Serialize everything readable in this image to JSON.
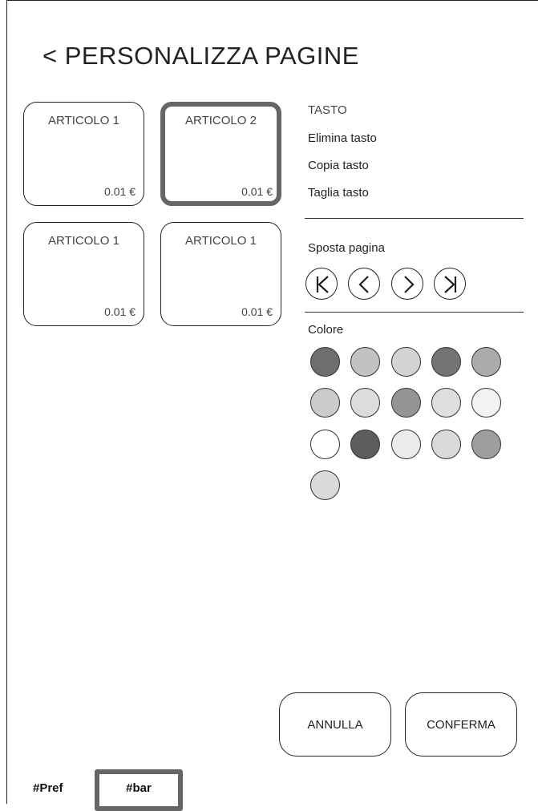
{
  "header": {
    "title": "< PERSONALIZZA PAGINE"
  },
  "tiles": [
    {
      "name": "ARTICOLO 1",
      "price": "0.01 €",
      "selected": false
    },
    {
      "name": "ARTICOLO 2",
      "price": "0.01 €",
      "selected": true
    },
    {
      "name": "ARTICOLO 1",
      "price": "0.01 €",
      "selected": false
    },
    {
      "name": "ARTICOLO 1",
      "price": "0.01 €",
      "selected": false
    }
  ],
  "panel": {
    "section_title": "TASTO",
    "actions": [
      "Elimina tasto",
      "Copia tasto",
      "Taglia tasto"
    ],
    "move_label": "Sposta pagina",
    "move_buttons": [
      "first-page-icon",
      "previous-page-icon",
      "next-page-icon",
      "last-page-icon"
    ],
    "color_label": "Colore",
    "colors": [
      "#6e6e6e",
      "#c2c2c2",
      "#d3d3d3",
      "#747474",
      "#ababab",
      "#cbcbcb",
      "#dcdcdc",
      "#959595",
      "#dedede",
      "#f2f2f2",
      "#ffffff",
      "#5d5d5d",
      "#ebebeb",
      "#d9d9d9",
      "#9e9e9e",
      "#dadada"
    ]
  },
  "footer": {
    "cancel_label": "ANNULLA",
    "confirm_label": "CONFERMA",
    "pref_label": "#Pref",
    "bar_label": "#bar"
  }
}
